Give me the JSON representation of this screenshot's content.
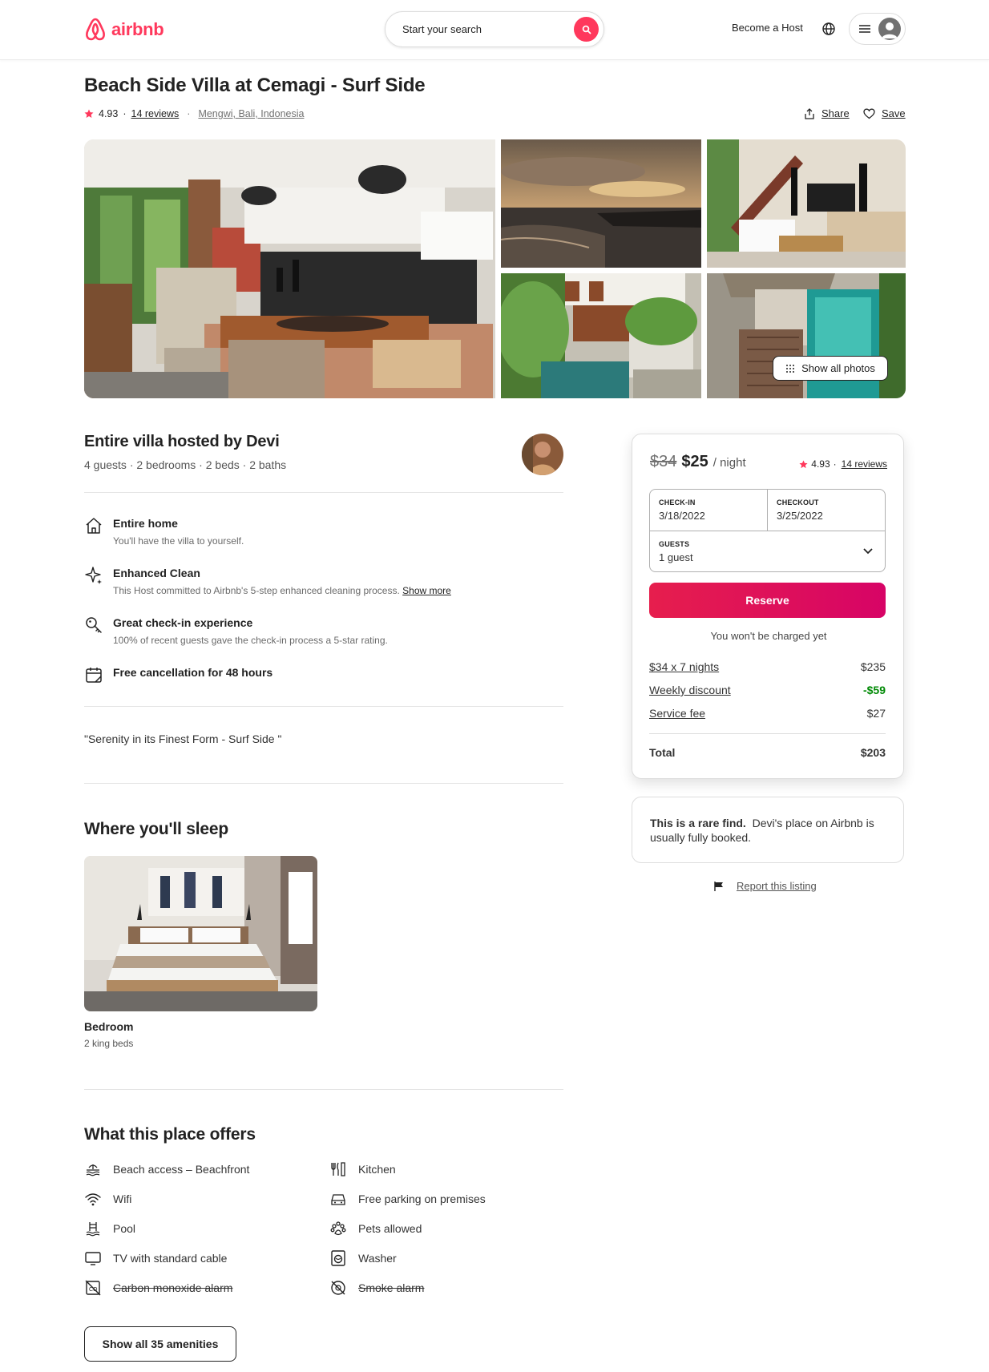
{
  "header": {
    "logo_text": "airbnb",
    "search_placeholder": "Start your search",
    "become_host": "Become a Host",
    "brand_color": "#FF385C"
  },
  "listing": {
    "title": "Beach Side Villa at Cemagi - Surf Side",
    "rating": "4.93",
    "reviews": "14 reviews",
    "location": "Mengwi, Bali, Indonesia",
    "share_label": "Share",
    "save_label": "Save",
    "show_all_photos": "Show all photos"
  },
  "overview": {
    "heading": "Entire villa hosted by Devi",
    "summary": "4 guests · 2 bedrooms · 2 beds · 2 baths"
  },
  "highlights": [
    {
      "title": "Entire home",
      "desc": "You'll have the villa to yourself.",
      "icon": "home-icon"
    },
    {
      "title": "Enhanced Clean",
      "desc": "This Host committed to Airbnb's 5-step enhanced cleaning process.",
      "link": "Show more",
      "icon": "sparkle-icon"
    },
    {
      "title": "Great check-in experience",
      "desc": "100% of recent guests gave the check-in process a 5-star rating.",
      "icon": "key-icon"
    },
    {
      "title": "Free cancellation for 48 hours",
      "icon": "calendar-icon"
    }
  ],
  "description": "\"Serenity in its Finest Form - Surf Side \"",
  "sleep": {
    "heading": "Where you'll sleep",
    "room": "Bedroom",
    "beds": "2 king beds"
  },
  "amenities": {
    "heading": "What this place offers",
    "left": [
      {
        "label": "Beach access – Beachfront",
        "icon": "beach-icon",
        "available": true
      },
      {
        "label": "Wifi",
        "icon": "wifi-icon",
        "available": true
      },
      {
        "label": "Pool",
        "icon": "pool-icon",
        "available": true
      },
      {
        "label": "TV with standard cable",
        "icon": "tv-icon",
        "available": true
      },
      {
        "label": "Carbon monoxide alarm",
        "icon": "co-alarm-icon",
        "available": false
      }
    ],
    "right": [
      {
        "label": "Kitchen",
        "icon": "kitchen-icon",
        "available": true
      },
      {
        "label": "Free parking on premises",
        "icon": "car-icon",
        "available": true
      },
      {
        "label": "Pets allowed",
        "icon": "paw-icon",
        "available": true
      },
      {
        "label": "Washer",
        "icon": "washer-icon",
        "available": true
      },
      {
        "label": "Smoke alarm",
        "icon": "smoke-alarm-icon",
        "available": false
      }
    ],
    "show_all": "Show all 35 amenities"
  },
  "booking": {
    "old_price": "$34",
    "price": "$25",
    "per": "/ night",
    "rating": "4.93",
    "reviews": "14 reviews",
    "checkin_label": "CHECK-IN",
    "checkin": "3/18/2022",
    "checkout_label": "CHECKOUT",
    "checkout": "3/25/2022",
    "guests_label": "GUESTS",
    "guests": "1 guest",
    "reserve": "Reserve",
    "no_charge": "You won't be charged yet",
    "lines": [
      {
        "label": "$34 x 7 nights",
        "value": "$235"
      },
      {
        "label": "Weekly discount",
        "value": "-$59"
      },
      {
        "label": "Service fee",
        "value": "$27"
      }
    ],
    "total_label": "Total",
    "total": "$203"
  },
  "rare_find": {
    "bold": "This is a rare find.",
    "text": "Devi's place on Airbnb is usually fully booked."
  },
  "report": "Report this listing"
}
